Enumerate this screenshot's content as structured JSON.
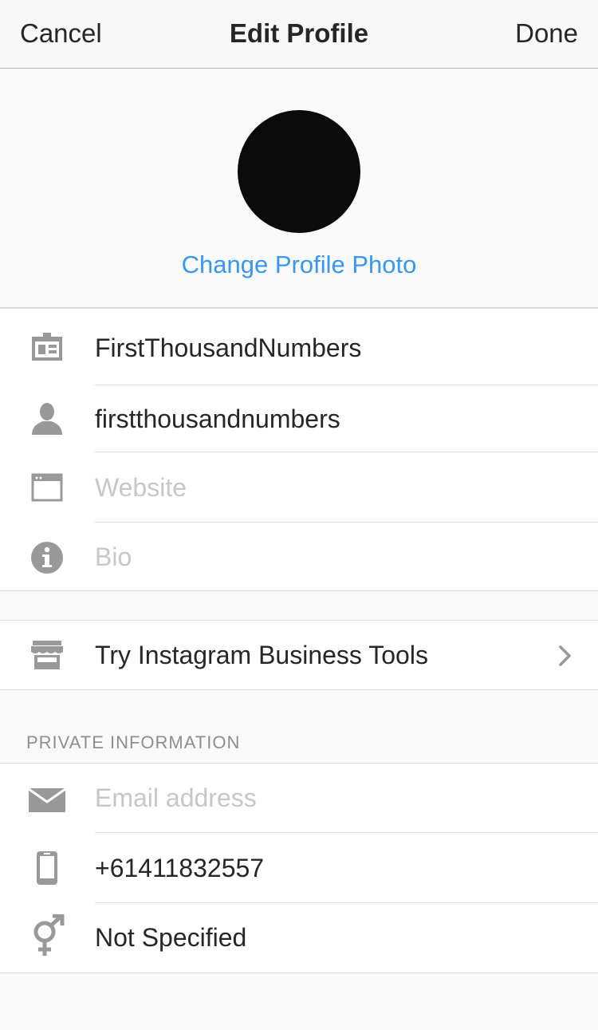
{
  "nav": {
    "cancel_label": "Cancel",
    "title": "Edit Profile",
    "done_label": "Done"
  },
  "photo": {
    "change_label": "Change Profile Photo"
  },
  "profile_fields": [
    {
      "icon": "id-card-icon",
      "value": "FirstThousandNumbers",
      "placeholder": ""
    },
    {
      "icon": "person-icon",
      "value": "firstthousandnumbers",
      "placeholder": ""
    },
    {
      "icon": "browser-window-icon",
      "value": "",
      "placeholder": "Website"
    },
    {
      "icon": "info-icon",
      "value": "",
      "placeholder": "Bio"
    }
  ],
  "business": {
    "icon": "storefront-icon",
    "label": "Try Instagram Business Tools"
  },
  "private_info": {
    "header": "PRIVATE INFORMATION",
    "fields": [
      {
        "icon": "envelope-icon",
        "value": "",
        "placeholder": "Email address"
      },
      {
        "icon": "phone-icon",
        "value": "+61411832557",
        "placeholder": ""
      },
      {
        "icon": "gender-icon",
        "value": "Not Specified",
        "placeholder": ""
      }
    ]
  },
  "colors": {
    "link_blue": "#3897f0",
    "icon_gray": "#999999",
    "placeholder_gray": "#c7c7c7",
    "text_dark": "#262626"
  }
}
